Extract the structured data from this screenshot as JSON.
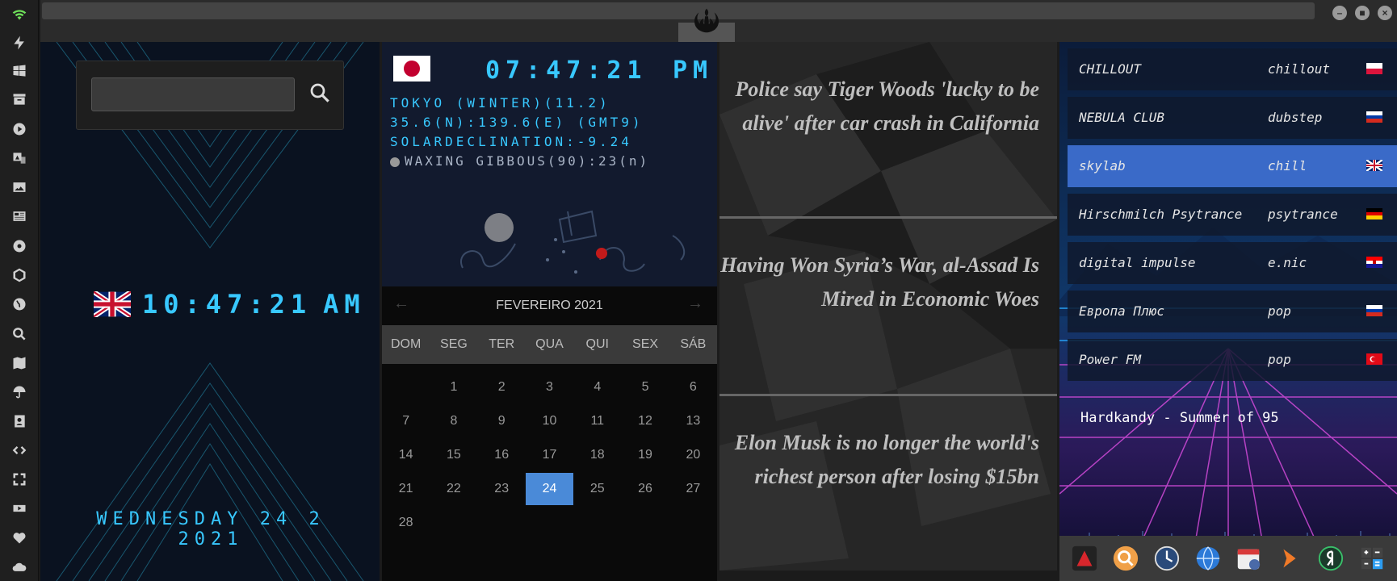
{
  "dock": {
    "icons": [
      "wifi-icon",
      "lightning-icon",
      "windows-icon",
      "archive-icon",
      "play-icon",
      "translate-icon",
      "image-icon",
      "news-icon",
      "settings-icon",
      "hexagon-icon",
      "globe-icon",
      "search-icon",
      "map-icon",
      "umbrella-icon",
      "contacts-icon",
      "code-icon",
      "fullscreen-icon",
      "youtube-icon",
      "heart-icon",
      "cloud-icon"
    ]
  },
  "titlebar": {
    "logo": "rebel-alliance-icon"
  },
  "uk": {
    "time": "10:47:21",
    "ampm": "AM",
    "date": "WEDNESDAY 24 2 2021"
  },
  "jp": {
    "time": "07:47:21",
    "ampm": "PM",
    "line1": "TOKYO (WINTER)(11.2)",
    "line2": "35.6(N):139.6(E) (GMT9)",
    "line3": "SOLARDECLINATION:-9.24",
    "moon": "WAXING GIBBOUS(90):23(n)"
  },
  "calendar": {
    "month": "FEVEREIRO 2021",
    "dow": [
      "DOM",
      "SEG",
      "TER",
      "QUA",
      "QUI",
      "SEX",
      "SÁB"
    ],
    "days": [
      "",
      "1",
      "2",
      "3",
      "4",
      "5",
      "6",
      "7",
      "8",
      "9",
      "10",
      "11",
      "12",
      "13",
      "14",
      "15",
      "16",
      "17",
      "18",
      "19",
      "20",
      "21",
      "22",
      "23",
      "24",
      "25",
      "26",
      "27",
      "28"
    ],
    "today": "24"
  },
  "news": [
    "Police say Tiger Woods 'lucky to be alive' after car crash in California",
    "Having Won Syria’s War, al-Assad Is Mired in Economic Woes",
    "Elon Musk is no longer the world's richest person after losing $15bn"
  ],
  "radio": {
    "stations": [
      {
        "name": "CHILLOUT",
        "genre": "chillout",
        "flag": "poland"
      },
      {
        "name": "NEBULA CLUB",
        "genre": "dubstep",
        "flag": "russia"
      },
      {
        "name": "skylab",
        "genre": "chill",
        "flag": "uk"
      },
      {
        "name": "Hirschmilch Psytrance",
        "genre": "psytrance",
        "flag": "germany"
      },
      {
        "name": "digital impulse",
        "genre": "e.nic",
        "flag": "croatia"
      },
      {
        "name": "Европа Плюс",
        "genre": "pop",
        "flag": "russia"
      },
      {
        "name": "Power FM",
        "genre": "pop",
        "flag": "turkey"
      }
    ],
    "now_playing": "Hardkandy - Summer of 95",
    "active_index": 2
  },
  "taskbar": [
    "app-red-icon",
    "search-app-icon",
    "clock-app-icon",
    "globe-app-icon",
    "calendar-app-icon",
    "arrow-app-icon",
    "yandex-icon",
    "calculator-icon"
  ]
}
